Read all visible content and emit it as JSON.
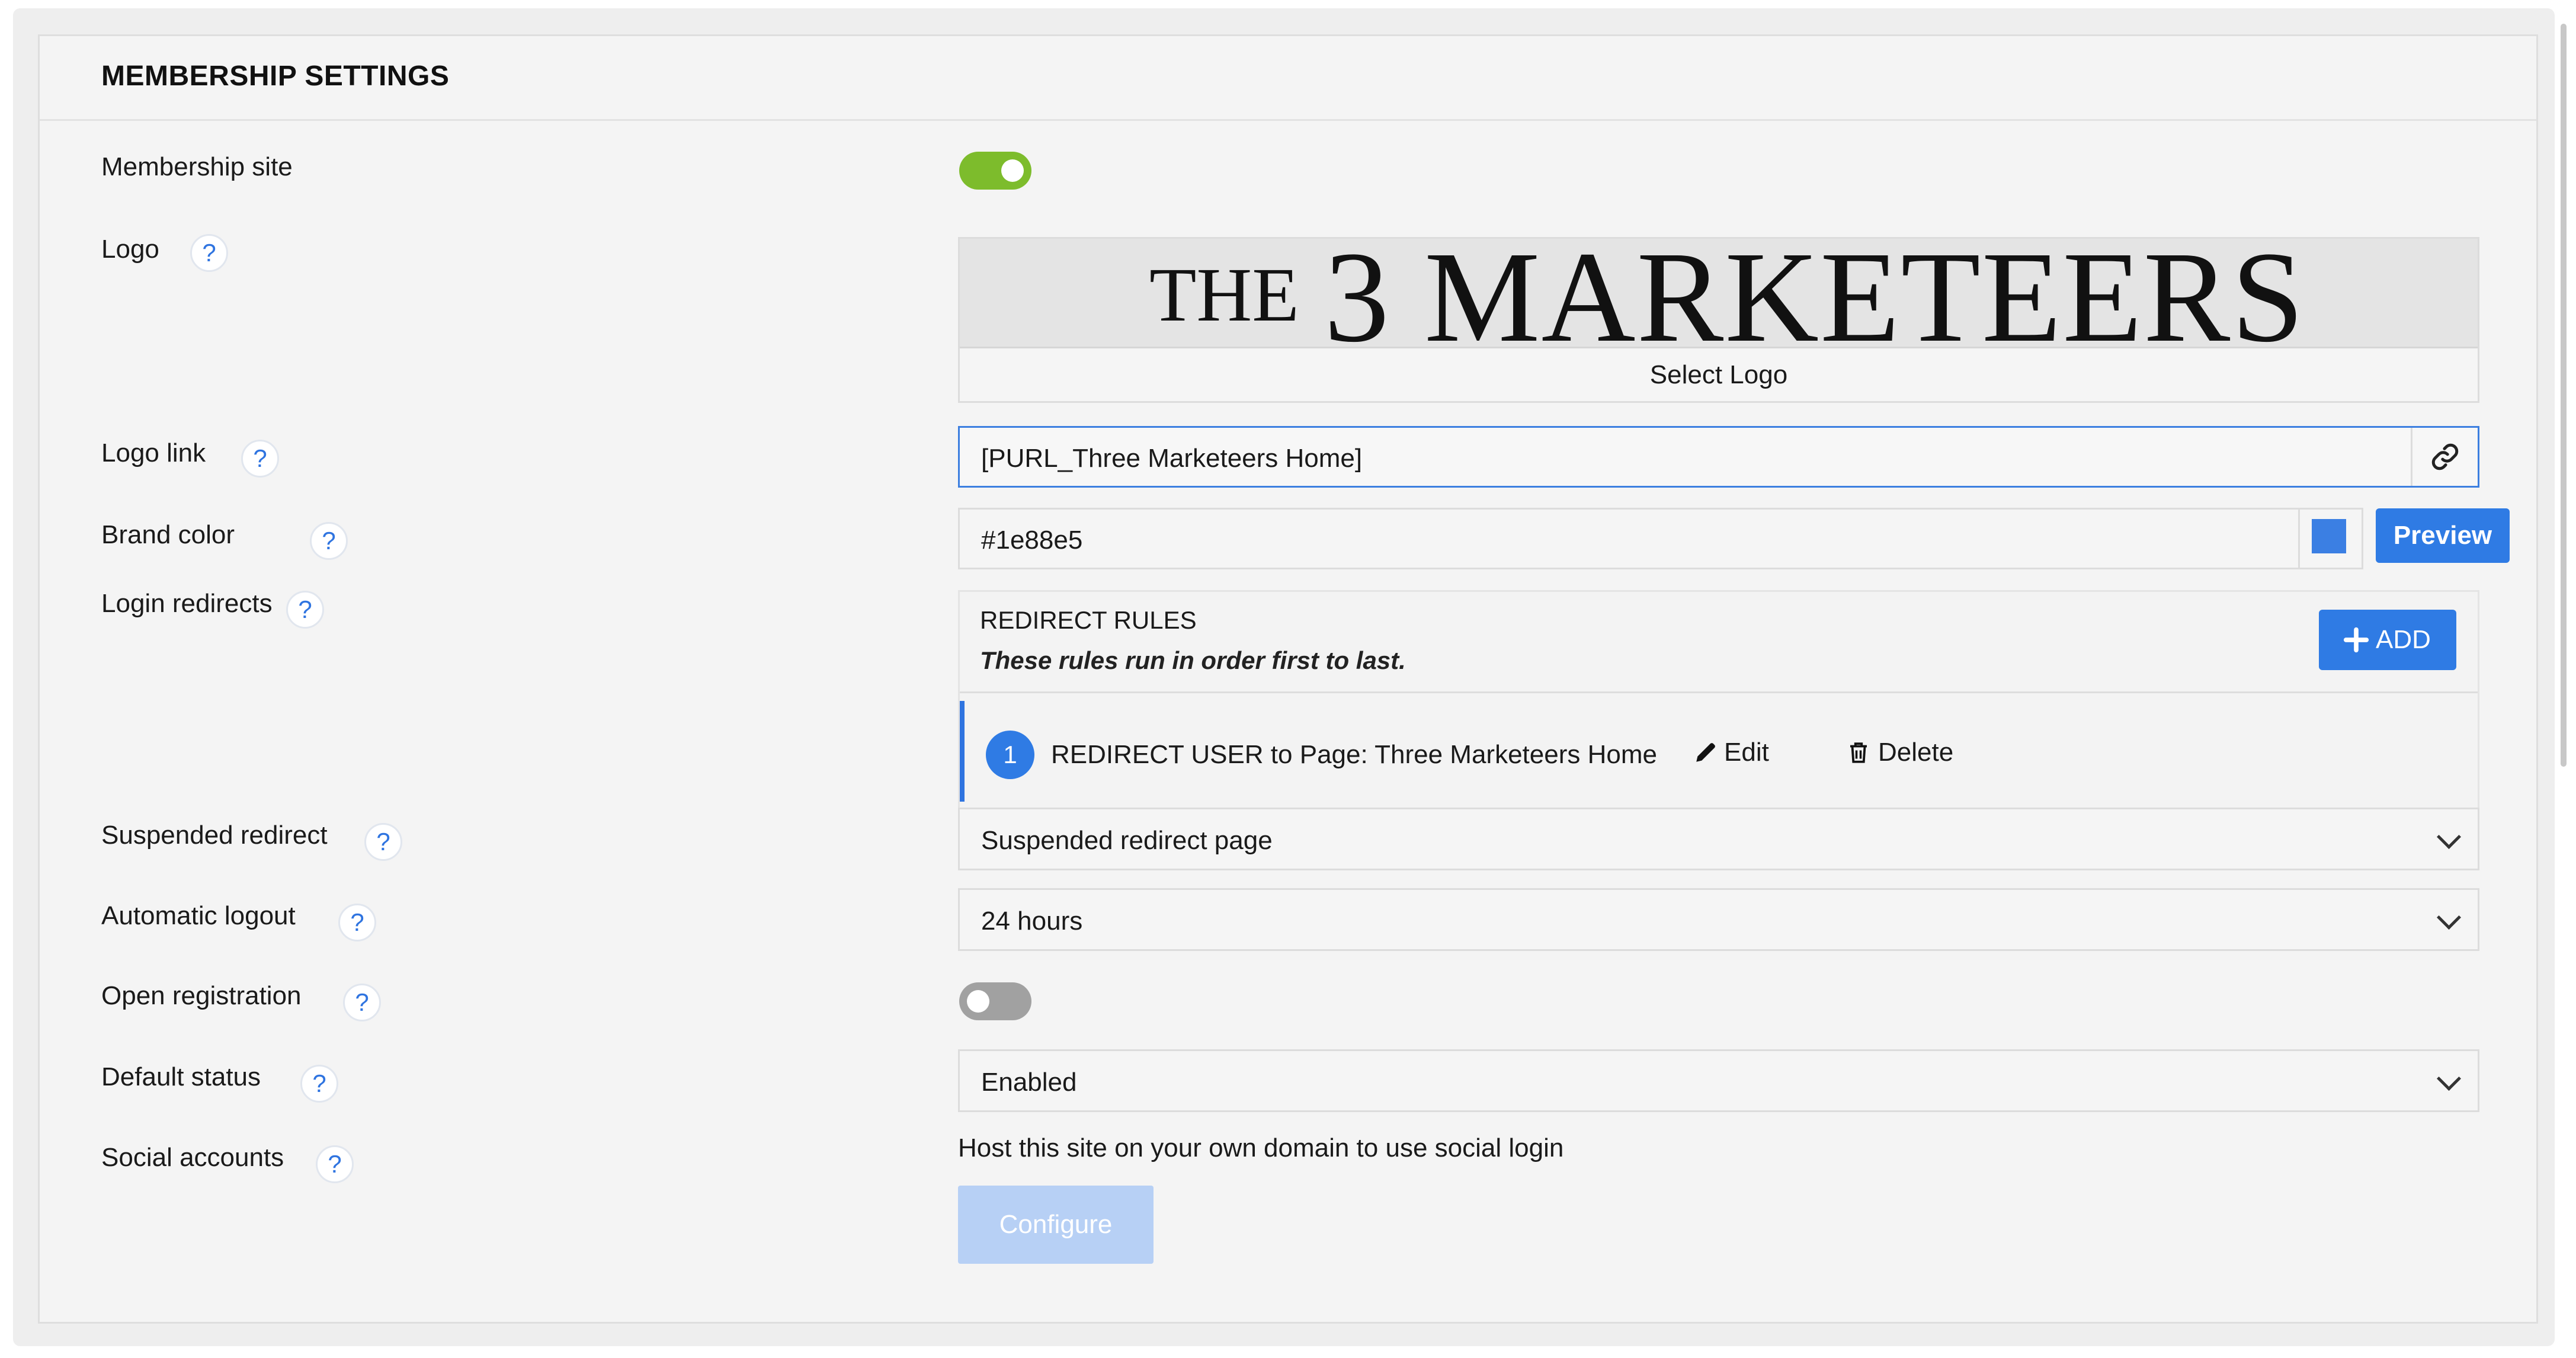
{
  "panel": {
    "title": "MEMBERSHIP SETTINGS"
  },
  "fields": {
    "membership_site": {
      "label": "Membership site",
      "enabled": true
    },
    "logo": {
      "label": "Logo",
      "image_line1": "THE",
      "image_line2": "3 MARKETEERS",
      "select_label": "Select Logo"
    },
    "logo_link": {
      "label": "Logo link",
      "value": "[PURL_Three Marketeers Home]"
    },
    "brand_color": {
      "label": "Brand color",
      "value": "#1e88e5",
      "swatch": "#3b7fe3",
      "preview_label": "Preview"
    },
    "login_redirects": {
      "label": "Login redirects",
      "rules_title": "REDIRECT RULES",
      "rules_subtitle": "These rules run in order first to last.",
      "add_label": "ADD",
      "rules": [
        {
          "number": "1",
          "text": "REDIRECT USER to Page: Three Marketeers Home",
          "edit_label": "Edit",
          "delete_label": "Delete"
        }
      ]
    },
    "suspended_redirect": {
      "label": "Suspended redirect",
      "value": "Suspended redirect page"
    },
    "automatic_logout": {
      "label": "Automatic logout",
      "value": "24 hours"
    },
    "open_registration": {
      "label": "Open registration",
      "enabled": false
    },
    "default_status": {
      "label": "Default status",
      "value": "Enabled"
    },
    "social_accounts": {
      "label": "Social accounts",
      "note": "Host this site on your own domain to use social login",
      "configure_label": "Configure"
    }
  },
  "help_glyph": "?",
  "icons": [
    "question-circle-icon",
    "link-icon",
    "plus-icon",
    "pencil-icon",
    "trash-icon",
    "chevron-down-icon"
  ],
  "colors": {
    "accent": "#2f7be4",
    "toggle_on": "#7dbc2c",
    "toggle_off": "#a1a1a1",
    "configure_disabled": "#b7d0f5"
  }
}
